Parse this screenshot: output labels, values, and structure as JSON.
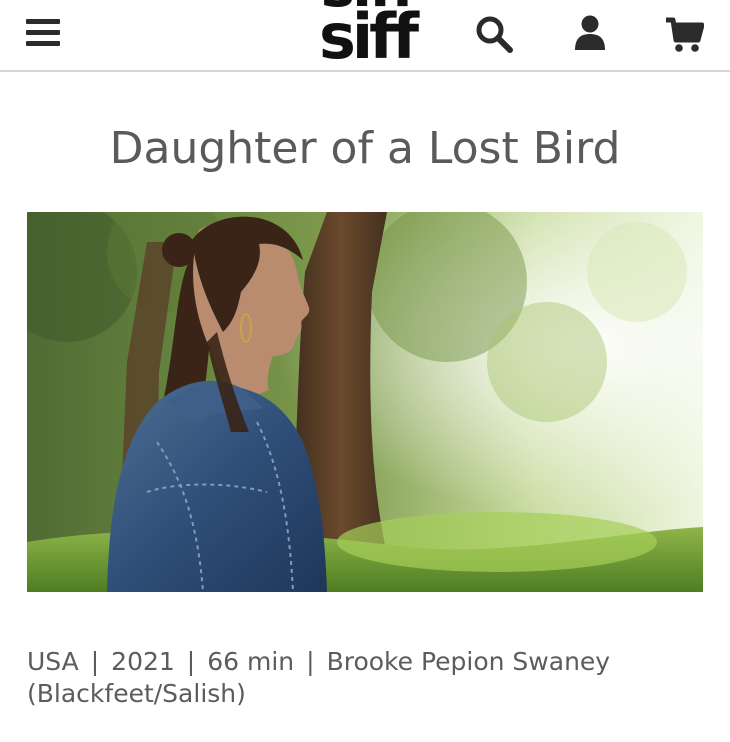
{
  "header": {
    "logo_top": "siff",
    "logo_bottom": "siff",
    "icons": [
      "menu-icon",
      "search-icon",
      "account-icon",
      "cart-icon"
    ]
  },
  "film": {
    "title": "Daughter of a Lost Bird",
    "country": "USA",
    "year": "2021",
    "runtime": "66 min",
    "director_line1": "Brooke Pepion Swaney",
    "director_line2": "(Blackfeet/Salish)",
    "separator": "|"
  },
  "colors": {
    "text": "#5c5c5c",
    "header_icons": "#2b2b2b",
    "divider": "#d6d6d6"
  }
}
